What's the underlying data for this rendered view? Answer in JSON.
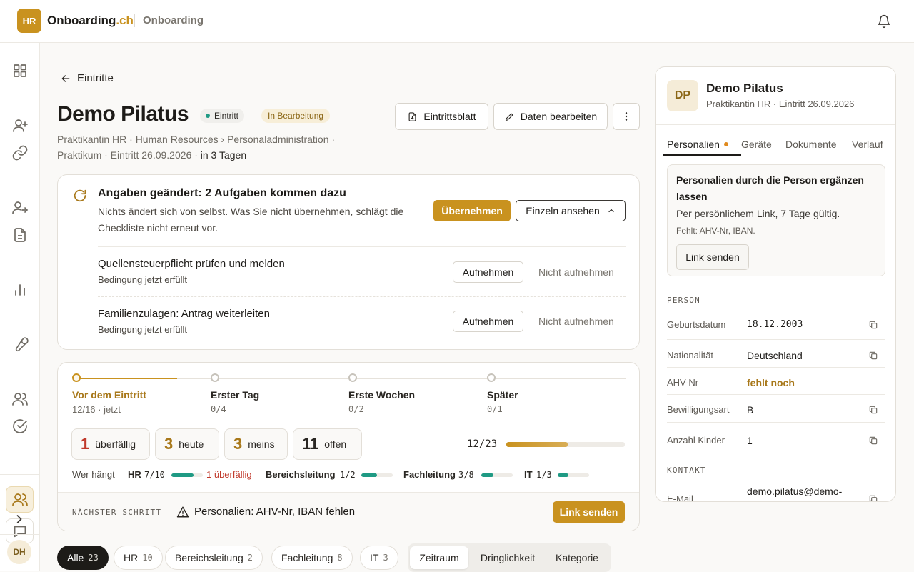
{
  "header": {
    "logo_initials": "HR",
    "brand_main": "Onboarding",
    "brand_suffix": ".ch",
    "section": "Onboarding"
  },
  "sidebar": {
    "user_initials": "DH"
  },
  "page": {
    "back_label": "Eintritte",
    "title": "Demo Pilatus",
    "badge_type": "Eintritt",
    "badge_status": "In Bearbeitung",
    "subline": "Praktikantin HR · Human Resources › Personaladministration · Praktikum · Eintritt 26.09.2026 ·",
    "subline_strong": "in 3 Tagen",
    "btn_sheet": "Eintrittsblatt",
    "btn_edit": "Daten bearbeiten"
  },
  "changes": {
    "title": "Angaben geändert: 2 Aufgaben kommen dazu",
    "description": "Nichts ändert sich von selbst. Was Sie nicht übernehmen, schlägt die Checkliste nicht erneut vor.",
    "accept_label": "Übernehmen",
    "review_label": "Einzeln ansehen",
    "items": [
      {
        "title": "Quellensteuerpflicht prüfen und melden",
        "sub": "Bedingung jetzt erfüllt",
        "add": "Aufnehmen",
        "skip": "Nicht aufnehmen"
      },
      {
        "title": "Familienzulagen: Antrag weiterleiten",
        "sub": "Bedingung jetzt erfüllt",
        "add": "Aufnehmen",
        "skip": "Nicht aufnehmen"
      }
    ]
  },
  "phases": [
    {
      "title": "Vor dem Eintritt",
      "sub": "12/16 · jetzt"
    },
    {
      "title": "Erster Tag",
      "sub": "0/4"
    },
    {
      "title": "Erste Wochen",
      "sub": "0/2"
    },
    {
      "title": "Später",
      "sub": "0/1"
    }
  ],
  "stats": [
    {
      "n": "1",
      "label": "überfällig",
      "color": "#c0392b"
    },
    {
      "n": "3",
      "label": "heute",
      "color": "#a8781a"
    },
    {
      "n": "3",
      "label": "meins",
      "color": "#a8781a"
    },
    {
      "n": "11",
      "label": "offen",
      "color": "#1d1b18"
    }
  ],
  "progress": {
    "label": "12/23",
    "value": 0.52
  },
  "blocking": {
    "label": "Wer hängt",
    "groups": [
      {
        "name": "HR",
        "count": "7/10",
        "value": 0.7,
        "extra": "1 überfällig"
      },
      {
        "name": "Bereichsleitung",
        "count": "1/2",
        "value": 0.5
      },
      {
        "name": "Fachleitung",
        "count": "3/8",
        "value": 0.375
      },
      {
        "name": "IT",
        "count": "1/3",
        "value": 0.33
      }
    ]
  },
  "next_step": {
    "label": "NÄCHSTER SCHRITT",
    "text": "Personalien: AHV-Nr, IBAN fehlen",
    "action": "Link senden"
  },
  "filters": [
    {
      "label": "Alle",
      "count": "23"
    },
    {
      "label": "HR",
      "count": "10"
    },
    {
      "label": "Bereichsleitung",
      "count": "2"
    },
    {
      "label": "Fachleitung",
      "count": "8"
    },
    {
      "label": "IT",
      "count": "3"
    }
  ],
  "sort": [
    "Zeitraum",
    "Dringlichkeit",
    "Kategorie"
  ],
  "person": {
    "initials": "DP",
    "name": "Demo Pilatus",
    "meta": "Praktikantin HR · Eintritt 26.09.2026",
    "tabs": [
      "Personalien",
      "Geräte",
      "Dokumente",
      "Verlauf"
    ],
    "request": {
      "title": "Personalien durch die Person ergänzen lassen",
      "sub": "Per persönlichem Link, 7 Tage gültig.",
      "missing": "Fehlt: AHV-Nr, IBAN.",
      "action": "Link senden"
    },
    "section_person": "PERSON",
    "fields": [
      {
        "k": "Geburtsdatum",
        "v": "18.12.2003"
      },
      {
        "k": "Nationalität",
        "v": "Deutschland"
      },
      {
        "k": "AHV-Nr",
        "v": "fehlt noch"
      },
      {
        "k": "Bewilligungsart",
        "v": "B"
      },
      {
        "k": "Anzahl Kinder",
        "v": "1"
      }
    ],
    "section_contact": "KONTAKT",
    "email_label": "E-Mail",
    "email_value": "demo.pilatus@demo-"
  }
}
